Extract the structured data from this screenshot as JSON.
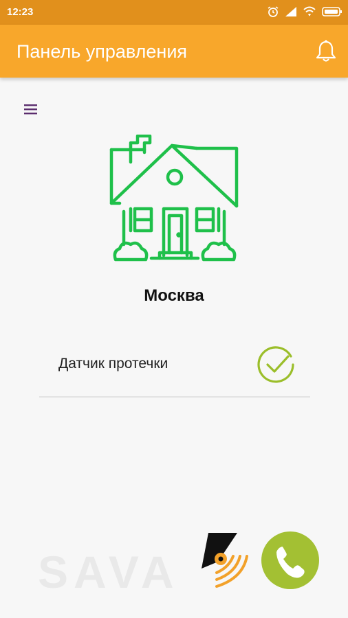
{
  "status_bar": {
    "time": "12:23",
    "icons": [
      "alarm-icon",
      "signal-icon",
      "wifi-icon",
      "battery-icon"
    ]
  },
  "app_bar": {
    "title": "Панель управления",
    "action_icon": "bell-icon"
  },
  "location": {
    "name": "Москва",
    "icon": "house-icon"
  },
  "sensors": [
    {
      "label": "Датчик протечки",
      "status": "ok",
      "status_icon": "check-circle-icon"
    }
  ],
  "brand": {
    "text": "SAVA"
  },
  "call_button": {
    "icon": "phone-icon"
  },
  "colors": {
    "status_bar": "#e1901c",
    "app_bar": "#f8a72b",
    "house": "#1fc04a",
    "check": "#9bbe2a",
    "call": "#a3c033",
    "menu": "#5b2d6d"
  }
}
